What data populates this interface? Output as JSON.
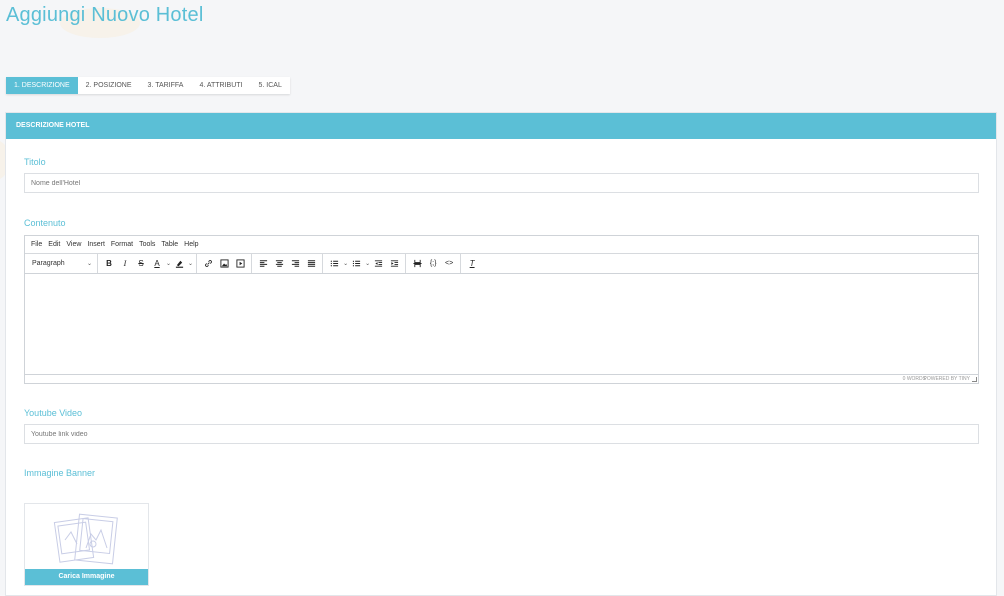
{
  "page": {
    "title": "Aggiungi Nuovo Hotel"
  },
  "tabs": [
    {
      "label": "1. DESCRIZIONE",
      "active": true
    },
    {
      "label": "2. POSIZIONE",
      "active": false
    },
    {
      "label": "3. TARIFFA",
      "active": false
    },
    {
      "label": "4. ATTRIBUTI",
      "active": false
    },
    {
      "label": "5. ICAL",
      "active": false
    }
  ],
  "section": {
    "header": "DESCRIZIONE HOTEL"
  },
  "titolo": {
    "label": "Titolo",
    "placeholder": "Nome dell'Hotel",
    "value": ""
  },
  "contenuto": {
    "label": "Contenuto",
    "menu": [
      "File",
      "Edit",
      "View",
      "Insert",
      "Format",
      "Tools",
      "Table",
      "Help"
    ],
    "block_format": "Paragraph",
    "toolbar_icons": [
      "bold-icon",
      "italic-icon",
      "strikethrough-icon",
      "text-color-icon",
      "highlight-icon",
      "link-icon",
      "image-icon",
      "media-icon",
      "align-left-icon",
      "align-center-icon",
      "align-right-icon",
      "align-justify-icon",
      "numbered-list-icon",
      "bullet-list-icon",
      "outdent-icon",
      "indent-icon",
      "page-break-icon",
      "code-sample-icon",
      "source-code-icon",
      "clear-formatting-icon"
    ],
    "word_count": "0 WORDS",
    "powered_by": "POWERED BY TINY"
  },
  "youtube": {
    "label": "Youtube Video",
    "placeholder": "Youtube link video",
    "value": ""
  },
  "banner": {
    "label": "Immagine Banner",
    "button_label": "Carica Immagine"
  },
  "colors": {
    "accent": "#5bbfd6",
    "background": "#f5f6f8"
  }
}
